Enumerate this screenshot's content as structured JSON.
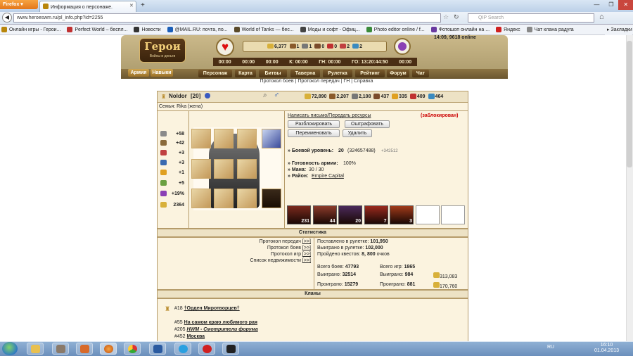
{
  "browser": {
    "menu_button": "Firefox",
    "tab_title": "Информация о персонаже.",
    "url": "www.heroeswm.ru/pl_info.php?id=2255",
    "search_placeholder": "QIP Search",
    "window_buttons": [
      "—",
      "❐",
      "✕"
    ],
    "bookmarks": [
      {
        "label": "Онлайн игры - Герои...",
        "color": "#b8860b"
      },
      {
        "label": "Perfect World – беспл...",
        "color": "#c03030"
      },
      {
        "label": "Новости",
        "color": "#333"
      },
      {
        "label": "@MAIL.RU: почта, по...",
        "color": "#1b5eb8"
      },
      {
        "label": "World of Tanks — бес...",
        "color": "#5a4a2a"
      },
      {
        "label": "Моды и софт - Офиц...",
        "color": "#444"
      },
      {
        "label": "Photo editor online / f...",
        "color": "#3a8a3a"
      },
      {
        "label": "Фотошоп онлайн на ...",
        "color": "#6a3aa0"
      },
      {
        "label": "Яндекс",
        "color": "#d02020"
      },
      {
        "label": "Чат клана радуга",
        "color": "#888"
      }
    ],
    "bookmarks_menu": "Закладки"
  },
  "game": {
    "logo_title": "Герои",
    "logo_subtitle": "Войны и деньги",
    "server_time": "14:09, 9618 online",
    "resources": [
      {
        "value": "6,377",
        "color": "#d8b03a"
      },
      {
        "value": "1",
        "color": "#8a5a2a"
      },
      {
        "value": "1",
        "color": "#777"
      },
      {
        "value": "0",
        "color": "#7a4a2a"
      },
      {
        "value": "0",
        "color": "#c03030"
      },
      {
        "value": "2",
        "color": "#c04040"
      },
      {
        "value": "2",
        "color": "#3a8ac0"
      }
    ],
    "timers": [
      "00:00",
      "00:00",
      "00:00",
      "К: 00:00",
      "ГН: 00:00",
      "ГО: 13:20:44:50",
      "00:00"
    ],
    "nav_left": [
      "Армия",
      "Навыки"
    ],
    "nav": [
      "Персонаж",
      "Карта",
      "Битвы",
      "Таверна",
      "Рулетка",
      "Рейтинг",
      "Форум",
      "Чат"
    ],
    "sublinks": "Протокол боев | Протокол передач | ГН | Справка"
  },
  "profile": {
    "name": "Noldor",
    "level": "[20]",
    "family": "Семья: Rika (жена)",
    "resources": [
      {
        "value": "72,890",
        "color": "#d8b03a"
      },
      {
        "value": "2,207",
        "color": "#8a5a2a"
      },
      {
        "value": "2,108",
        "color": "#777"
      },
      {
        "value": "437",
        "color": "#7a4a2a"
      },
      {
        "value": "335",
        "color": "#e0a020"
      },
      {
        "value": "409",
        "color": "#c03030"
      },
      {
        "value": "464",
        "color": "#3a8ac0"
      }
    ],
    "stats": [
      {
        "icon": "sword-icon",
        "value": "+58",
        "color": "#8a8a8a"
      },
      {
        "icon": "shield-icon",
        "value": "+42",
        "color": "#8a6a3a"
      },
      {
        "icon": "wand-icon",
        "value": "+3",
        "color": "#c04040"
      },
      {
        "icon": "book-icon",
        "value": "+3",
        "color": "#3a6ab0"
      },
      {
        "icon": "rainbow-icon",
        "value": "+1",
        "color": "#e0a020"
      },
      {
        "icon": "horseshoe-icon",
        "value": "+5",
        "color": "#6aa040"
      },
      {
        "icon": "potion-icon",
        "value": "+19%",
        "color": "#8a3fb5"
      },
      {
        "icon": "gold-icon",
        "value": "2364",
        "color": "#d8b03a"
      }
    ],
    "write_letter": "Написать письмо/Передать ресурсы",
    "blocked": "(заблокирован)",
    "buttons": [
      "Разблокировать",
      "Оштрафовать",
      "Переименовать",
      "Удалить"
    ],
    "combat_level_label": "» Боевой уровень:",
    "combat_level": "20",
    "combat_exp": "(324657488)",
    "combat_exp_plus": "+342512",
    "army_ready_label": "» Готовность армии:",
    "army_ready": "100%",
    "mana_label": "» Мана:",
    "mana": "30 / 30",
    "region_label": "» Район:",
    "region": "Empire Capital",
    "army": [
      {
        "count": "231",
        "color": "#7a2a1e"
      },
      {
        "count": "44",
        "color": "#8a3a2a"
      },
      {
        "count": "20",
        "color": "#4a2a5a"
      },
      {
        "count": "7",
        "color": "#9a2a1e"
      },
      {
        "count": "3",
        "color": "#a03a1a"
      },
      {
        "count": "",
        "color": ""
      },
      {
        "count": "",
        "color": ""
      }
    ]
  },
  "statistics": {
    "title": "Статистика",
    "links": [
      "Протокол передач",
      "Протокол боев",
      "Протокол игр",
      "Список недвижимости"
    ],
    "link_suffix": "[>>]",
    "roulette_bet_label": "Поставлено в рулетке:",
    "roulette_bet": "101,950",
    "roulette_won_label": "Выиграно в рулетке:",
    "roulette_won": "102,000",
    "quests_label": "Пройдено квестов:",
    "quests": "8, 800",
    "quests_unit": "очков",
    "battles_label": "Всего боев:",
    "battles": "47793",
    "games_label": "Всего игр:",
    "games": "1865",
    "won_label": "Выиграно:",
    "won_battles": "32514",
    "won_games": "984",
    "won_gold": "313,083",
    "lost_label": "Проиграно:",
    "lost_battles": "15279",
    "lost_games": "881",
    "lost_gold": "170,760"
  },
  "clans": {
    "title": "Кланы",
    "items": [
      {
        "num": "#18",
        "name": "†Орден Миротворцев†",
        "bold": true
      },
      {
        "num": "#55",
        "name": "На самом краю любимого рая",
        "bold": true
      },
      {
        "num": "#205",
        "name": "HWM - Смотрители форума",
        "bold": true
      },
      {
        "num": "#452",
        "name": "Москва",
        "bold": true
      }
    ]
  },
  "taskbar": {
    "language": "RU",
    "time": "16:10",
    "date": "01.04.2013"
  }
}
